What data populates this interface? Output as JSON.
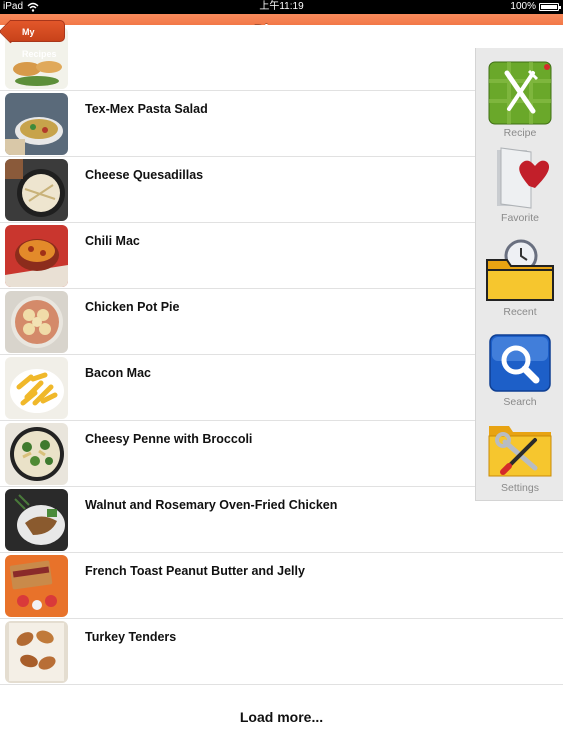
{
  "status_bar": {
    "device": "iPad",
    "time": "上午11:19",
    "battery": "100%"
  },
  "nav": {
    "back_label": "My Recipes",
    "title": "Dinners"
  },
  "recipes": [
    {
      "title": ""
    },
    {
      "title": "Tex-Mex Pasta Salad"
    },
    {
      "title": "Cheese Quesadillas"
    },
    {
      "title": "Chili Mac"
    },
    {
      "title": "Chicken Pot Pie"
    },
    {
      "title": "Bacon Mac"
    },
    {
      "title": "Cheesy Penne with Broccoli"
    },
    {
      "title": "Walnut and Rosemary Oven-Fried Chicken"
    },
    {
      "title": "French Toast Peanut Butter and Jelly"
    },
    {
      "title": "Turkey Tenders"
    }
  ],
  "load_more": "Load more...",
  "side_menu": [
    {
      "label": "Recipe",
      "icon": "fork-knife-icon"
    },
    {
      "label": "Favorite",
      "icon": "heart-folder-icon"
    },
    {
      "label": "Recent",
      "icon": "clock-folder-icon"
    },
    {
      "label": "Search",
      "icon": "magnifier-icon"
    },
    {
      "label": "Settings",
      "icon": "tools-folder-icon"
    }
  ],
  "colors": {
    "accent": "#ef6a36",
    "side_bg": "#e9e9e9"
  }
}
